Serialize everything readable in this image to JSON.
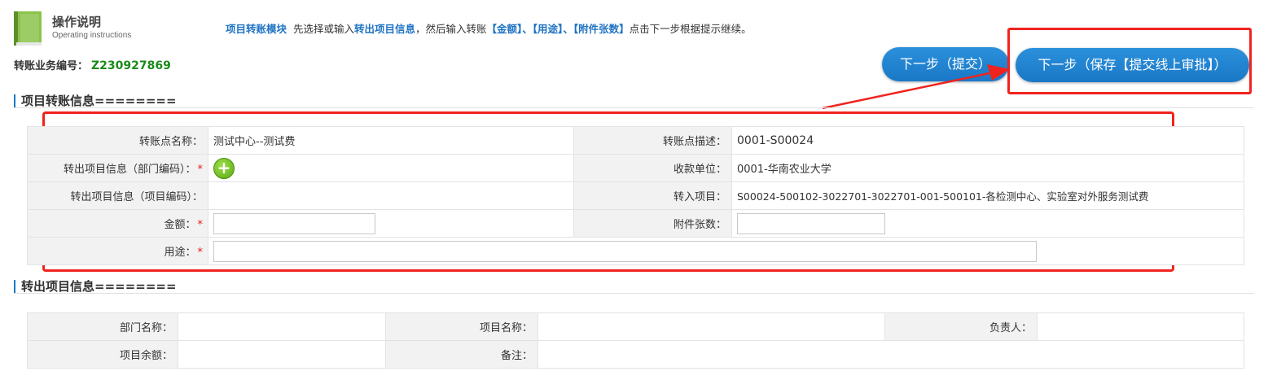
{
  "header": {
    "help_title": "操作说明",
    "help_subtitle": "Operating instructions",
    "instruction": {
      "module": "项目转账模块",
      "part1": "先选择或输入",
      "target": "转出项目信息",
      "part2": "，然后输入转账",
      "amount": "【金额】",
      "sep1": "、",
      "purpose": "【用途】",
      "sep2": "、",
      "attachments": "【附件张数】",
      "part3": "点击下一步根据提示继续。"
    },
    "biz_no_label": "转账业务编号：",
    "biz_no_value": "Z230927869"
  },
  "actions": {
    "submit_label": "下一步（提交）",
    "save_label": "下一步（保存【提交线上审批】）"
  },
  "section1": {
    "title": "项目转账信息========",
    "rows": {
      "point_name_label": "转账点名称：",
      "point_name_value": "测试中心--测试费",
      "point_desc_label": "转账点描述：",
      "point_desc_value": "0001-S00024",
      "out_dept_label": "转出项目信息（部门编码）：",
      "payee_label": "收款单位：",
      "payee_value": "0001-华南农业大学",
      "out_proj_label": "转出项目信息（项目编码）：",
      "in_proj_label": "转入项目：",
      "in_proj_value": "S00024-500102-3022701-3022701-001-500101-各检测中心、实验室对外服务测试费",
      "amount_label": "金额：",
      "attach_label": "附件张数：",
      "purpose_label": "用途：",
      "required_mark": "*"
    }
  },
  "section2": {
    "title": "转出项目信息========",
    "rows": {
      "dept_name_label": "部门名称：",
      "proj_name_label": "项目名称：",
      "owner_label": "负责人：",
      "balance_label": "项目余额：",
      "remark_label": "备注："
    }
  },
  "icons": {
    "book": "book-icon",
    "add": "plus-circle-icon",
    "arrow": "red-arrow-annotation"
  },
  "colors": {
    "accent": "#1a78c6",
    "highlight": "#f0231e",
    "biz_no": "#1a8a1a",
    "required": "#e8181d"
  }
}
